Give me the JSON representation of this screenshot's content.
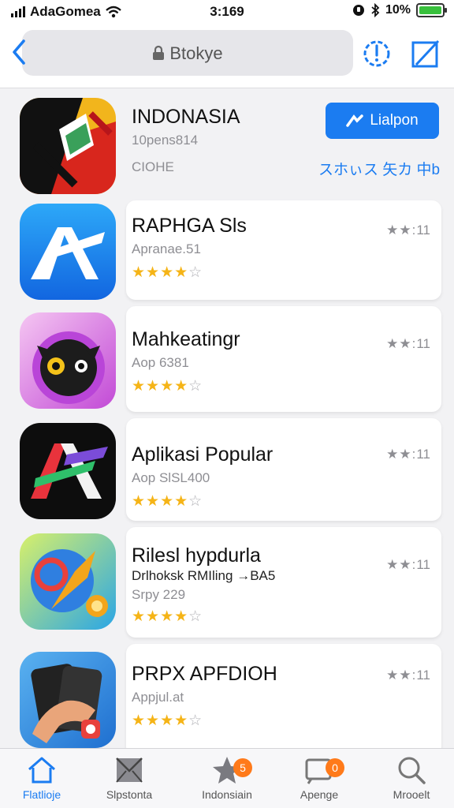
{
  "status_bar": {
    "carrier": "AdaGomea",
    "time": "3:169",
    "battery_percent": "10%",
    "battery_level": 1.0,
    "accent_battery": "#38c03c"
  },
  "navbar": {
    "back_icon": "chevron-left-icon",
    "search_text": "Btokye",
    "update_icon": "update-clock-icon",
    "compose_icon": "compose-icon",
    "accent": "#1b7cf1"
  },
  "featured": {
    "name": "INDONASIA",
    "subtitle": "10pens814",
    "category": "CIOHE",
    "get_button": "Lialpon",
    "more_link": "スホぃス 矢カ 中b"
  },
  "apps": [
    {
      "name": "RAPHGA Sls",
      "subtitle": "Apranae.51",
      "stars_filled": 3.5,
      "stars_text": "★★★★",
      "stars_empty": "☆",
      "rating_text": "11"
    },
    {
      "name": "Mahkeatingr",
      "subtitle": "Aop 6381",
      "stars_filled": 4,
      "stars_text": "★★★★",
      "stars_empty": "☆",
      "rating_text": "11"
    },
    {
      "name": "Aplikasi Popular",
      "subtitle": "Aop SlSL400",
      "stars_filled": 3.5,
      "stars_text": "★★★★",
      "stars_empty": "☆",
      "rating_text": "11"
    },
    {
      "name": "Rilesl hypdurla",
      "subtitle": "Drlhoksk RMIling →BA5",
      "subtitle2": "Srpy 229",
      "stars_filled": 4,
      "stars_text": "★★★★",
      "stars_empty": "☆",
      "rating_text": "11"
    },
    {
      "name": "PRPX APFDIOH",
      "subtitle": "Appjul.at",
      "stars_filled": 4,
      "stars_text": "★★★★",
      "stars_empty": "☆",
      "rating_text": "11"
    }
  ],
  "tabs": [
    {
      "label": "Flatlioje",
      "icon": "home-icon",
      "active": true
    },
    {
      "label": "Slpstonta",
      "icon": "inbox-icon",
      "active": false
    },
    {
      "label": "Indonsiain",
      "icon": "star-tray-icon",
      "active": false,
      "badge": "5"
    },
    {
      "label": "Apenge",
      "icon": "updates-icon",
      "active": false,
      "badge": "0"
    },
    {
      "label": "Mrooelt",
      "icon": "search-icon",
      "active": false
    }
  ]
}
